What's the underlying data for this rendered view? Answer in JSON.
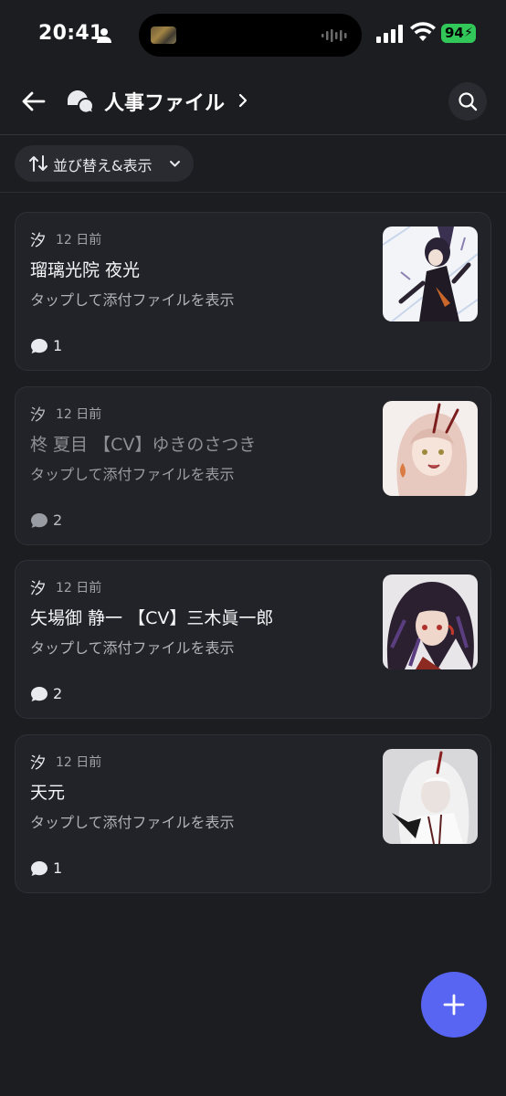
{
  "status": {
    "time": "20:41",
    "battery": "94"
  },
  "header": {
    "title": "人事ファイル"
  },
  "sort": {
    "label": "並び替え&表示"
  },
  "posts": [
    {
      "author": "汐",
      "date": "12 日前",
      "title": "瑠璃光院 夜光",
      "subtitle": "タップして添付ファイルを表示",
      "comments": "1"
    },
    {
      "author": "汐",
      "date": "12 日前",
      "title": "柊 夏目 【CV】ゆきのさつき",
      "subtitle": "タップして添付ファイルを表示",
      "comments": "2"
    },
    {
      "author": "汐",
      "date": "12 日前",
      "title": "矢場御 静一 【CV】三木眞一郎",
      "subtitle": "タップして添付ファイルを表示",
      "comments": "2"
    },
    {
      "author": "汐",
      "date": "12 日前",
      "title": "天元",
      "subtitle": "タップして添付ファイルを表示",
      "comments": "1"
    }
  ],
  "colors": {
    "background": "#1c1d21",
    "card": "#222328",
    "accent": "#5865f2",
    "battery": "#32c759"
  }
}
